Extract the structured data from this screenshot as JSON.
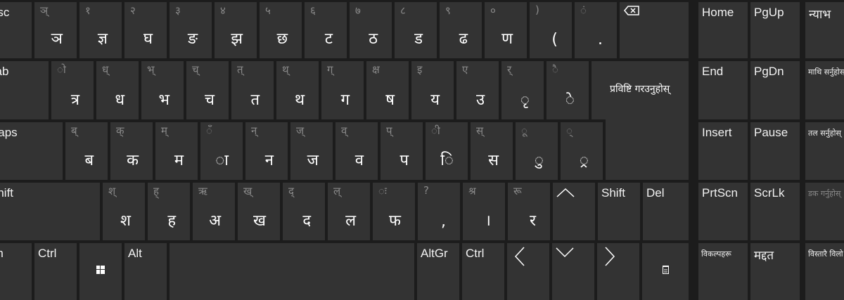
{
  "colors": {
    "background": "#1c1c1c",
    "key": "#333333",
    "primary_text": "#ffffff",
    "secondary_text": "#8a8a8a"
  },
  "row1": {
    "esc": "Esc",
    "keys": [
      [
        "ञ्",
        "ञ"
      ],
      [
        "१",
        "ज्ञ"
      ],
      [
        "२",
        "घ"
      ],
      [
        "३",
        "ङ"
      ],
      [
        "४",
        "झ"
      ],
      [
        "५",
        "छ"
      ],
      [
        "६",
        "ट"
      ],
      [
        "७",
        "ठ"
      ],
      [
        "८",
        "ड"
      ],
      [
        "९",
        "ढ"
      ],
      [
        "०",
        "ण"
      ],
      [
        ")",
        "("
      ],
      [
        "ं",
        "."
      ]
    ],
    "backspace_icon": "backspace-icon"
  },
  "row2": {
    "tab": "Tab",
    "keys": [
      [
        "ो",
        "त्र"
      ],
      [
        "ध्",
        "ध"
      ],
      [
        "भ्",
        "भ"
      ],
      [
        "च्",
        "च"
      ],
      [
        "त्",
        "त"
      ],
      [
        "थ्",
        "थ"
      ],
      [
        "ग्",
        "ग"
      ],
      [
        "क्ष",
        "ष"
      ],
      [
        "इ",
        "य"
      ],
      [
        "ए",
        "उ"
      ],
      [
        "र्",
        "ृ"
      ],
      [
        "ै",
        "े"
      ]
    ],
    "enter": "प्रविष्टि गरउनुहोस्"
  },
  "row3": {
    "caps": "Caps",
    "keys": [
      [
        "ब्",
        "ब"
      ],
      [
        "क्",
        "क"
      ],
      [
        "म्",
        "म"
      ],
      [
        "ँ",
        "ा"
      ],
      [
        "न्",
        "न"
      ],
      [
        "ज्",
        "ज"
      ],
      [
        "व्",
        "व"
      ],
      [
        "प्",
        "प"
      ],
      [
        "ी",
        "ि"
      ],
      [
        "स्",
        "स"
      ],
      [
        "ू",
        "ु"
      ],
      [
        "्",
        "्र"
      ]
    ]
  },
  "row4": {
    "shift_left": "Shift",
    "keys": [
      [
        "श्",
        "श"
      ],
      [
        "ह्",
        "ह"
      ],
      [
        "ऋ",
        "अ"
      ],
      [
        "ख्",
        "ख"
      ],
      [
        "द्",
        "द"
      ],
      [
        "ल्",
        "ल"
      ],
      [
        "ः",
        "फ"
      ],
      [
        "?",
        ","
      ],
      [
        "श्र",
        "।"
      ],
      [
        "रू",
        "र"
      ]
    ],
    "shift_right": "Shift",
    "del": "Del"
  },
  "row5": {
    "fn": "Fn",
    "ctrl_left": "Ctrl",
    "alt": "Alt",
    "altgr": "AltGr",
    "ctrl_right": "Ctrl"
  },
  "nav": {
    "home": "Home",
    "pgup": "PgUp",
    "end": "End",
    "pgdn": "PgDn",
    "insert": "Insert",
    "pause": "Pause",
    "prtscn": "PrtScn",
    "scrlk": "ScrLk",
    "options": "विकल्पहरू",
    "help": "मद्दत"
  },
  "side": {
    "fade": "न्याभ",
    "move_up": "माथि सर्नुहोस्",
    "move_down": "तल सर्नुहोस्",
    "dock": "डक गर्नुहोस्",
    "fade_slow": "विस्तारै विलो"
  }
}
